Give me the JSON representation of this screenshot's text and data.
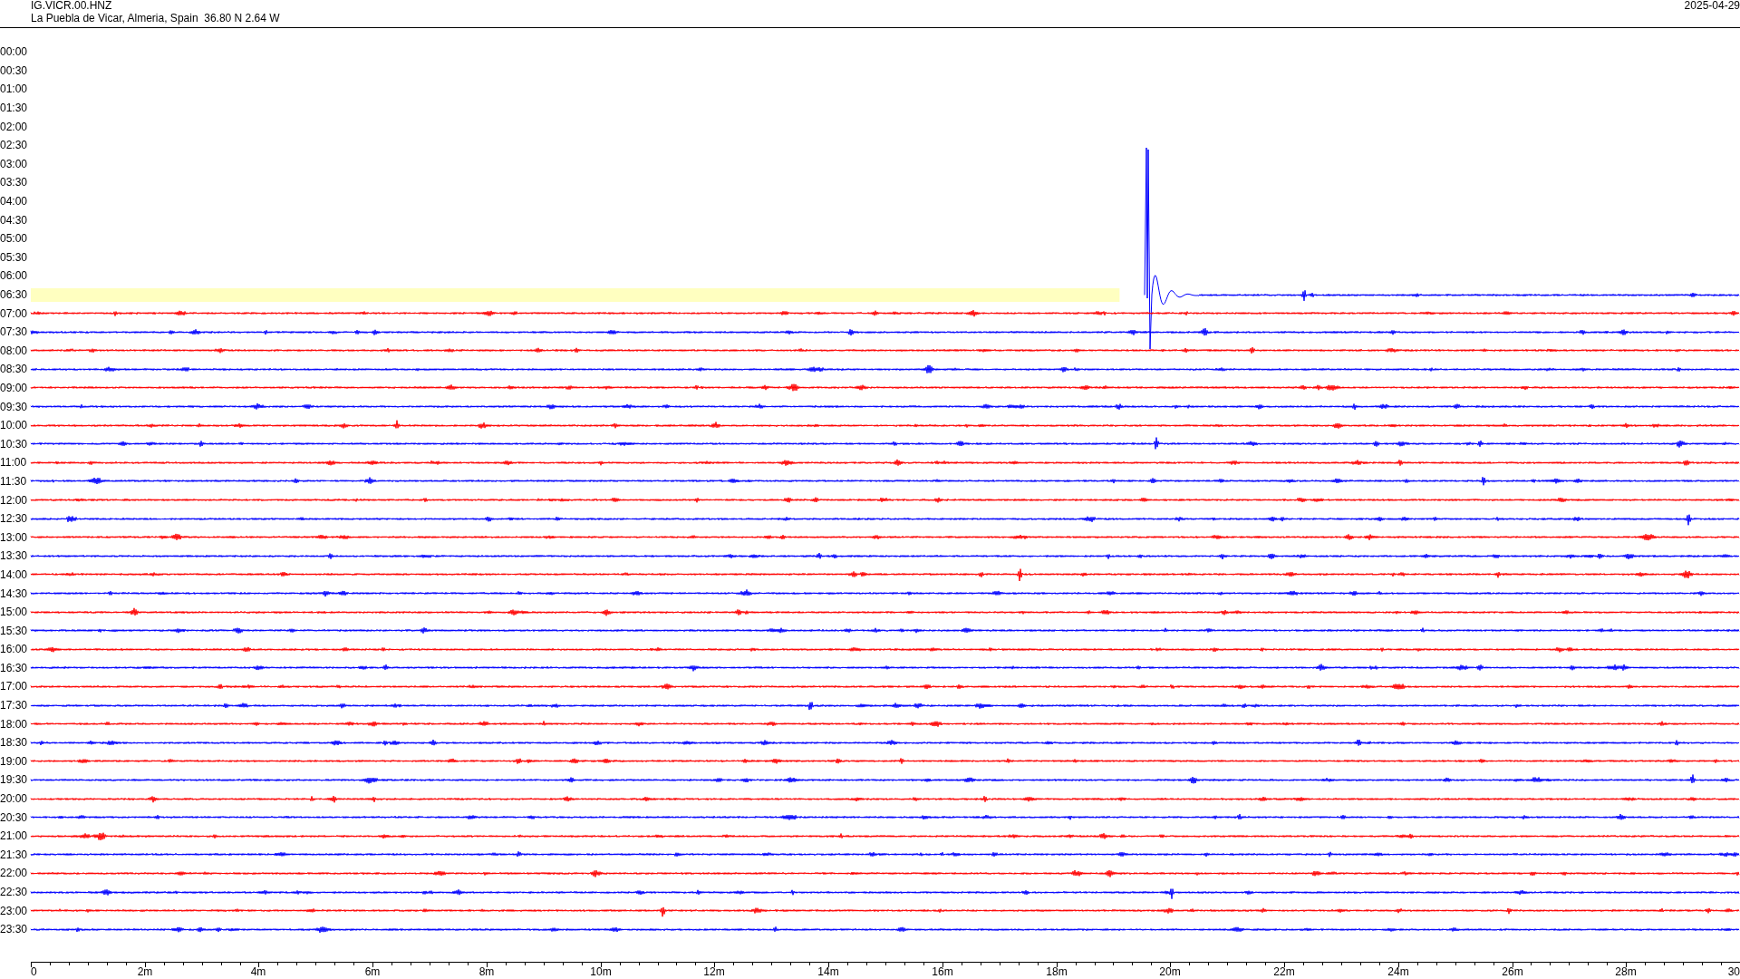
{
  "header": {
    "station": "IG.VICR.00.HNZ",
    "location": "La Puebla de Vicar, Almeria, Spain  36.80 N 2.64 W",
    "date": "2025-04-29"
  },
  "rows": [
    {
      "label": "00:00",
      "kind": "empty"
    },
    {
      "label": "00:30",
      "kind": "empty"
    },
    {
      "label": "01:00",
      "kind": "empty"
    },
    {
      "label": "01:30",
      "kind": "empty"
    },
    {
      "label": "02:00",
      "kind": "empty"
    },
    {
      "label": "02:30",
      "kind": "empty"
    },
    {
      "label": "03:00",
      "kind": "empty"
    },
    {
      "label": "03:30",
      "kind": "empty"
    },
    {
      "label": "04:00",
      "kind": "empty"
    },
    {
      "label": "04:30",
      "kind": "empty"
    },
    {
      "label": "05:00",
      "kind": "empty"
    },
    {
      "label": "05:30",
      "kind": "empty"
    },
    {
      "label": "06:00",
      "kind": "empty"
    },
    {
      "label": "06:30",
      "kind": "partial",
      "color": "#0000ff"
    },
    {
      "label": "07:00",
      "kind": "full",
      "color": "#ff0000"
    },
    {
      "label": "07:30",
      "kind": "full",
      "color": "#0000ff"
    },
    {
      "label": "08:00",
      "kind": "full",
      "color": "#ff0000"
    },
    {
      "label": "08:30",
      "kind": "full",
      "color": "#0000ff"
    },
    {
      "label": "09:00",
      "kind": "full",
      "color": "#ff0000"
    },
    {
      "label": "09:30",
      "kind": "full",
      "color": "#0000ff"
    },
    {
      "label": "10:00",
      "kind": "full",
      "color": "#ff0000"
    },
    {
      "label": "10:30",
      "kind": "full",
      "color": "#0000ff"
    },
    {
      "label": "11:00",
      "kind": "full",
      "color": "#ff0000"
    },
    {
      "label": "11:30",
      "kind": "full",
      "color": "#0000ff"
    },
    {
      "label": "12:00",
      "kind": "full",
      "color": "#ff0000"
    },
    {
      "label": "12:30",
      "kind": "full",
      "color": "#0000ff"
    },
    {
      "label": "13:00",
      "kind": "full",
      "color": "#ff0000"
    },
    {
      "label": "13:30",
      "kind": "full",
      "color": "#0000ff"
    },
    {
      "label": "14:00",
      "kind": "full",
      "color": "#ff0000"
    },
    {
      "label": "14:30",
      "kind": "full",
      "color": "#0000ff"
    },
    {
      "label": "15:00",
      "kind": "full",
      "color": "#ff0000"
    },
    {
      "label": "15:30",
      "kind": "full",
      "color": "#0000ff"
    },
    {
      "label": "16:00",
      "kind": "full",
      "color": "#ff0000"
    },
    {
      "label": "16:30",
      "kind": "full",
      "color": "#0000ff"
    },
    {
      "label": "17:00",
      "kind": "full",
      "color": "#ff0000"
    },
    {
      "label": "17:30",
      "kind": "full",
      "color": "#0000ff"
    },
    {
      "label": "18:00",
      "kind": "full",
      "color": "#ff0000"
    },
    {
      "label": "18:30",
      "kind": "full",
      "color": "#0000ff"
    },
    {
      "label": "19:00",
      "kind": "full",
      "color": "#ff0000"
    },
    {
      "label": "19:30",
      "kind": "full",
      "color": "#0000ff"
    },
    {
      "label": "20:00",
      "kind": "full",
      "color": "#ff0000"
    },
    {
      "label": "20:30",
      "kind": "full",
      "color": "#0000ff"
    },
    {
      "label": "21:00",
      "kind": "full",
      "color": "#ff0000"
    },
    {
      "label": "21:30",
      "kind": "full",
      "color": "#0000ff"
    },
    {
      "label": "22:00",
      "kind": "full",
      "color": "#ff0000"
    },
    {
      "label": "22:30",
      "kind": "full",
      "color": "#0000ff"
    },
    {
      "label": "23:00",
      "kind": "full",
      "color": "#ff0000"
    },
    {
      "label": "23:30",
      "kind": "full",
      "color": "#0000ff"
    }
  ],
  "axis": {
    "ticks": [
      "0",
      "2m",
      "4m",
      "6m",
      "8m",
      "10m",
      "12m",
      "14m",
      "16m",
      "18m",
      "20m",
      "22m",
      "24m",
      "26m",
      "28m",
      "30"
    ]
  }
}
